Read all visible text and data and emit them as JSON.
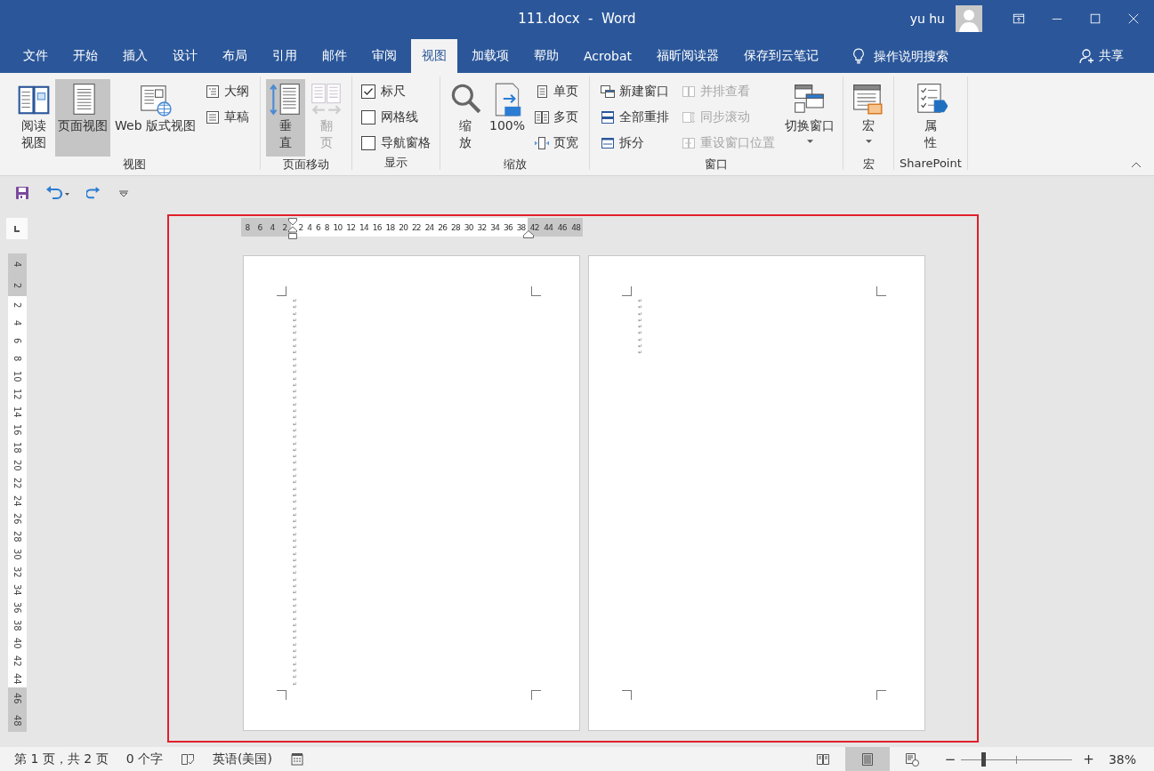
{
  "window": {
    "title": "111.docx  -  Word",
    "user": "yu hu"
  },
  "menu_tabs": [
    {
      "label": "文件",
      "selected": false
    },
    {
      "label": "开始",
      "selected": false
    },
    {
      "label": "插入",
      "selected": false
    },
    {
      "label": "设计",
      "selected": false
    },
    {
      "label": "布局",
      "selected": false
    },
    {
      "label": "引用",
      "selected": false
    },
    {
      "label": "邮件",
      "selected": false
    },
    {
      "label": "审阅",
      "selected": false
    },
    {
      "label": "视图",
      "selected": true
    },
    {
      "label": "加载项",
      "selected": false
    },
    {
      "label": "帮助",
      "selected": false
    },
    {
      "label": "Acrobat",
      "selected": false
    },
    {
      "label": "福昕阅读器",
      "selected": false
    },
    {
      "label": "保存到云笔记",
      "selected": false
    }
  ],
  "tell_me": "操作说明搜索",
  "share": "共享",
  "ribbon_groups": [
    {
      "name": "视图",
      "columns": [
        {
          "kind": "large",
          "label_lines": [
            "阅读",
            "视图"
          ],
          "selected": false,
          "disabled": false
        },
        {
          "kind": "large",
          "label_lines": [
            "页面视图"
          ],
          "selected": true,
          "disabled": false
        },
        {
          "kind": "large",
          "label_lines": [
            "Web 版式视图"
          ],
          "selected": false,
          "disabled": false
        },
        {
          "kind": "stack",
          "items": [
            {
              "kind": "small",
              "label": "大纲",
              "disabled": false
            },
            {
              "kind": "small",
              "label": "草稿",
              "disabled": false
            }
          ]
        }
      ]
    },
    {
      "name": "页面移动",
      "columns": [
        {
          "kind": "large",
          "label_lines": [
            "垂",
            "直"
          ],
          "selected": true,
          "disabled": false
        },
        {
          "kind": "large",
          "label_lines": [
            "翻",
            "页"
          ],
          "selected": false,
          "disabled": true
        }
      ]
    },
    {
      "name": "显示",
      "columns": [
        {
          "kind": "stack",
          "items": [
            {
              "kind": "check",
              "label": "标尺",
              "checked": true
            },
            {
              "kind": "check",
              "label": "网格线",
              "checked": false
            },
            {
              "kind": "check",
              "label": "导航窗格",
              "checked": false
            }
          ]
        }
      ]
    },
    {
      "name": "缩放",
      "columns": [
        {
          "kind": "large",
          "label_lines": [
            "缩",
            "放"
          ],
          "selected": false,
          "disabled": false
        },
        {
          "kind": "large",
          "label_lines": [
            "100%"
          ],
          "selected": false,
          "disabled": false
        },
        {
          "kind": "stack",
          "items": [
            {
              "kind": "small",
              "label": "单页",
              "disabled": false
            },
            {
              "kind": "small",
              "label": "多页",
              "disabled": false
            },
            {
              "kind": "small",
              "label": "页宽",
              "disabled": false
            }
          ]
        }
      ]
    },
    {
      "name": "窗口",
      "columns": [
        {
          "kind": "stack",
          "items": [
            {
              "kind": "small",
              "label": "新建窗口",
              "disabled": false
            },
            {
              "kind": "small",
              "label": "全部重排",
              "disabled": false
            },
            {
              "kind": "small",
              "label": "拆分",
              "disabled": false
            }
          ]
        },
        {
          "kind": "stack",
          "items": [
            {
              "kind": "small",
              "label": "并排查看",
              "disabled": true
            },
            {
              "kind": "small",
              "label": "同步滚动",
              "disabled": true
            },
            {
              "kind": "small",
              "label": "重设窗口位置",
              "disabled": true
            }
          ]
        },
        {
          "kind": "large",
          "label_lines": [
            "切换窗口"
          ],
          "selected": false,
          "disabled": false,
          "dropdown": true
        }
      ]
    },
    {
      "name": "宏",
      "columns": [
        {
          "kind": "large",
          "label_lines": [
            "宏"
          ],
          "selected": false,
          "disabled": false,
          "dropdown": true
        }
      ]
    },
    {
      "name": "SharePoint",
      "columns": [
        {
          "kind": "large",
          "label_lines": [
            "属",
            "性"
          ],
          "selected": false,
          "disabled": false
        }
      ]
    }
  ],
  "ruler": {
    "horizontal": [
      {
        "shaded": true,
        "ticks": [
          "8",
          "6",
          "4",
          "2"
        ]
      },
      {
        "shaded": false,
        "ticks": [
          "2",
          "4",
          "6",
          "8",
          "10",
          "12",
          "14",
          "16",
          "18",
          "20",
          "22",
          "24",
          "26",
          "28",
          "30",
          "32",
          "34",
          "36",
          "38"
        ]
      },
      {
        "shaded": true,
        "ticks": [
          "42",
          "44",
          "46",
          "48"
        ]
      }
    ],
    "vertical": [
      {
        "shaded": true,
        "ticks": [
          "4",
          "2"
        ]
      },
      {
        "shaded": false,
        "ticks": [
          "2",
          "4",
          "6",
          "8",
          "10",
          "12",
          "14",
          "16",
          "18",
          "20",
          "22",
          "24",
          "26",
          "28",
          "30",
          "32",
          "34",
          "36",
          "38",
          "40",
          "42",
          "44"
        ]
      },
      {
        "shaded": true,
        "ticks": [
          "46",
          "48"
        ]
      }
    ]
  },
  "pages": [
    {
      "marks": "↵↵↵↵↵↵↵↵↵↵↵↵↵↵↵↵↵↵↵↵↵↵↵↵↵↵↵↵↵↵↵↵↵↵↵↵↵↵↵↵↵↵↵↵↵↵↵↵↵↵↵↵↵↵↵↵↵↵↵↵"
    },
    {
      "marks": "↵↵↵↵↵↵↵↵↵"
    }
  ],
  "status_bar": {
    "page": "第 1 页，共 2 页",
    "words": "0 个字",
    "language": "英语(美国)",
    "views": [
      {
        "selected": false
      },
      {
        "selected": true
      },
      {
        "selected": false
      }
    ],
    "zoom_out": "−",
    "zoom_in": "+",
    "zoom": {
      "level": 0.18
    },
    "zoom_text": "38%"
  }
}
